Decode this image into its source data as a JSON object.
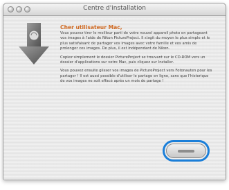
{
  "window": {
    "title": "Centre d'installation"
  },
  "icon": {
    "name": "download-arrow-icon"
  },
  "message": {
    "heading": "Cher utilisateur Mac,",
    "paragraphs": [
      "Vous pouvez tirer le meilleur parti de votre nouvel appareil photo en partageant vos images à l'aide de Nikon PictureProject. Il s'agit du moyen le plus simple et le plus satisfaisant de partager vos images avec votre famille et vos amis de prolonger ces images. De plus, il est indépendant de Nikon.",
      "Copiez simplement le dossier PictureProject se trouvant sur le CD-ROM vers un dossier d'applications sur votre Mac, puis cliquez sur Installer.",
      "Vous pouvez ensuite glisser vos images de PictureProject vers Fotonauten pour les partager ! Il est aussi possible d'utiliser le partage en ligne, sans que l'historique de vos images ne soit effacé après un mois de partage !"
    ]
  },
  "install_button": {
    "label": ""
  }
}
